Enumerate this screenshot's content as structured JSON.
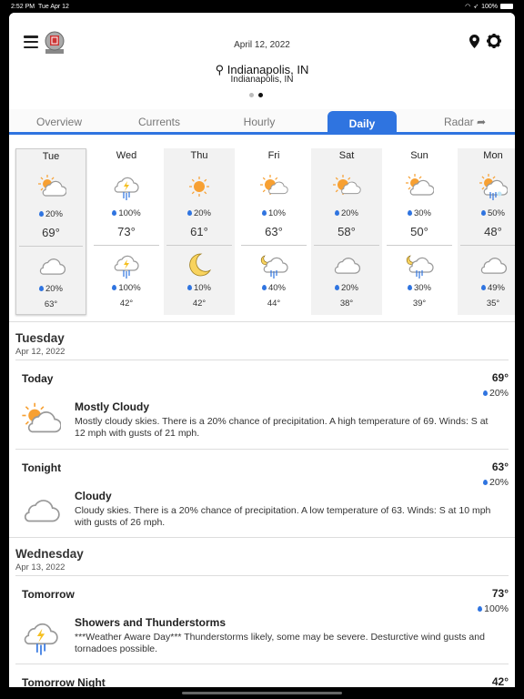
{
  "status_bar": {
    "time": "2:52 PM",
    "date": "Tue Apr 12",
    "battery": "100%"
  },
  "header": {
    "date": "April 12, 2022",
    "location": "Indianapolis, IN",
    "sublocation": "Indianapolis, IN"
  },
  "tabs": [
    {
      "label": "Overview"
    },
    {
      "label": "Currents"
    },
    {
      "label": "Hourly"
    },
    {
      "label": "Daily",
      "active": true
    },
    {
      "label": "Radar"
    }
  ],
  "accent": "#2f74e0",
  "days": [
    {
      "name": "Tue",
      "day_icon": "partly-cloudy",
      "day_precip": "20%",
      "high": "69°",
      "night_icon": "cloudy",
      "night_precip": "20%",
      "low": "63°"
    },
    {
      "name": "Wed",
      "day_icon": "thunderstorm",
      "day_precip": "100%",
      "high": "73°",
      "night_icon": "thunderstorm",
      "night_precip": "100%",
      "low": "42°"
    },
    {
      "name": "Thu",
      "day_icon": "sunny",
      "day_precip": "20%",
      "high": "61°",
      "night_icon": "moon",
      "night_precip": "10%",
      "low": "42°"
    },
    {
      "name": "Fri",
      "day_icon": "partly-sunny",
      "day_precip": "10%",
      "high": "63°",
      "night_icon": "night-showers",
      "night_precip": "40%",
      "low": "44°"
    },
    {
      "name": "Sat",
      "day_icon": "partly-sunny",
      "day_precip": "20%",
      "high": "58°",
      "night_icon": "cloudy",
      "night_precip": "20%",
      "low": "38°"
    },
    {
      "name": "Sun",
      "day_icon": "partly-cloudy",
      "day_precip": "30%",
      "high": "50°",
      "night_icon": "night-showers",
      "night_precip": "30%",
      "low": "39°"
    },
    {
      "name": "Mon",
      "day_icon": "rain-snow",
      "day_precip": "50%",
      "high": "48°",
      "night_icon": "cloudy",
      "night_precip": "49%",
      "low": "35°"
    }
  ],
  "details": [
    {
      "day": "Tuesday",
      "date": "Apr 12, 2022",
      "periods": [
        {
          "name": "Today",
          "temp": "69°",
          "precip": "20%",
          "icon": "partly-cloudy",
          "summary": "Mostly Cloudy",
          "text": "Mostly cloudy skies. There is a 20% chance of precipitation.  A high temperature of 69.  Winds: S at 12 mph with gusts of 21 mph."
        },
        {
          "name": "Tonight",
          "temp": "63°",
          "precip": "20%",
          "icon": "cloudy",
          "summary": "Cloudy",
          "text": "Cloudy skies. There is a 20% chance of precipitation.  A low temperature of 63.  Winds: S at 10 mph with gusts of 26 mph."
        }
      ]
    },
    {
      "day": "Wednesday",
      "date": "Apr 13, 2022",
      "periods": [
        {
          "name": "Tomorrow",
          "temp": "73°",
          "precip": "100%",
          "icon": "thunderstorm",
          "summary": "Showers and Thunderstorms",
          "text": "***Weather Aware Day*** Thunderstorms likely, some may be severe.  Desturctive wind gusts and tornadoes possible."
        },
        {
          "name": "Tomorrow Night",
          "temp": "42°"
        }
      ]
    }
  ]
}
